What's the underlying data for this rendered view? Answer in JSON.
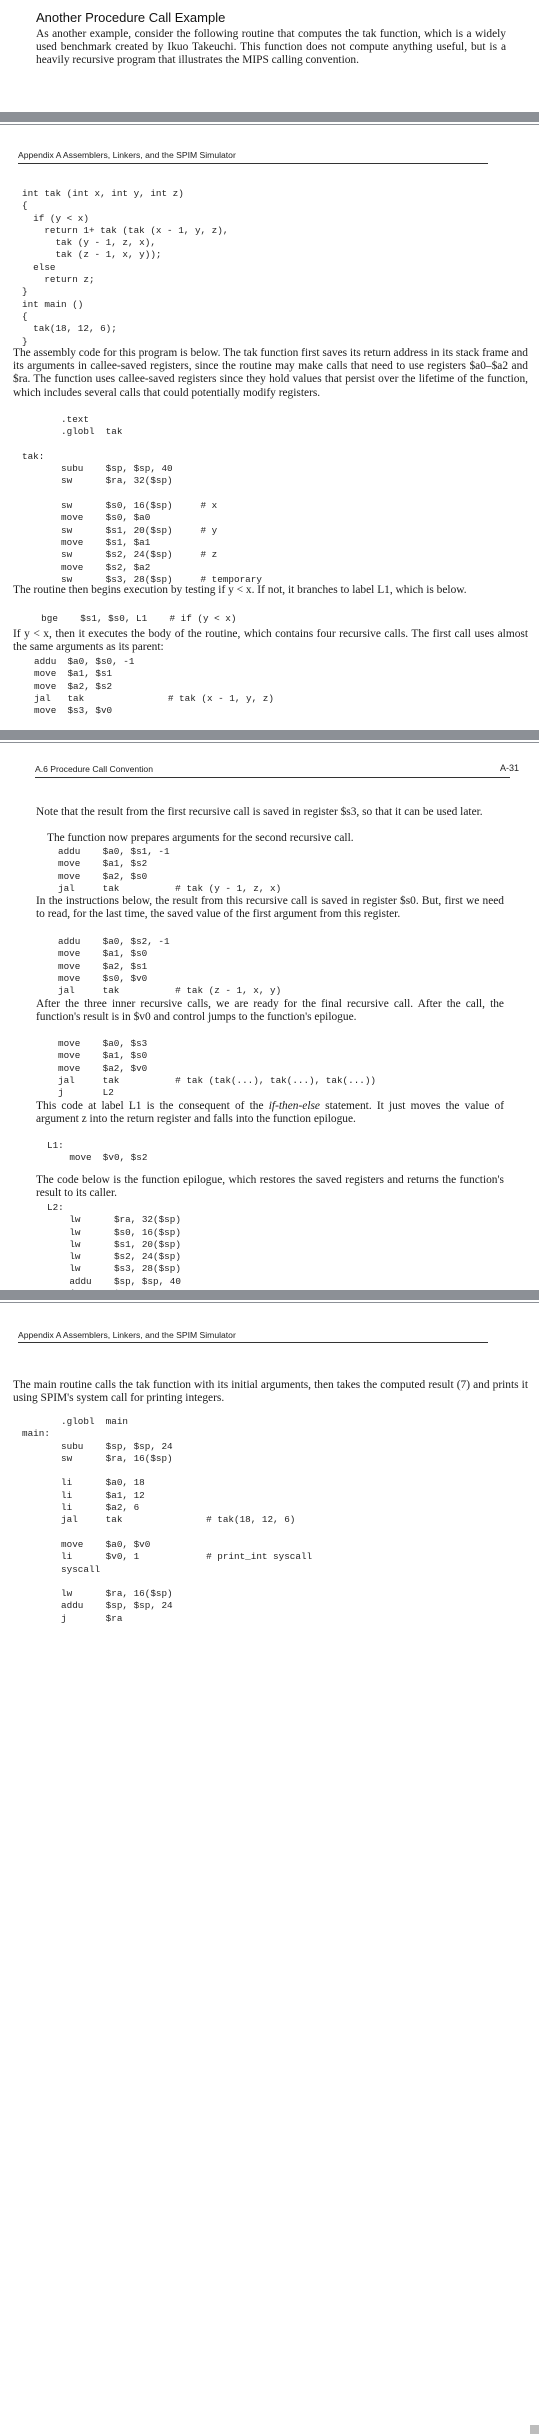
{
  "section1": {
    "title": "Another Procedure Call Example",
    "intro": "As another example, consider the following routine that computes the tak function, which is a widely used benchmark created by Ikuo Takeuchi. This function does not compute anything useful, but is a heavily recursive program that illustrates the MIPS calling convention."
  },
  "page1": {
    "header": "Appendix A   Assemblers, Linkers, and the SPIM Simulator",
    "c_code": "int tak (int x, int y, int z)\n{\n  if (y < x)\n    return 1+ tak (tak (x - 1, y, z),\n      tak (y - 1, z, x),\n      tak (z - 1, x, y));\n  else\n    return z;\n}\nint main ()\n{\n  tak(18, 12, 6);\n}",
    "p1": "The assembly code for this program is below. The tak function first saves its return address in its stack frame and its arguments in callee-saved registers, since the routine may make calls that need to use registers $a0–$a2 and $ra. The function uses callee-saved registers since they hold values that persist over the lifetime of the function, which includes several calls that could potentially modify registers.",
    "asm1": "       .text\n       .globl  tak\n\ntak:\n       subu    $sp, $sp, 40\n       sw      $ra, 32($sp)\n\n       sw      $s0, 16($sp)     # x\n       move    $s0, $a0\n       sw      $s1, 20($sp)     # y\n       move    $s1, $a1\n       sw      $s2, 24($sp)     # z\n       move    $s2, $a2\n       sw      $s3, 28($sp)     # temporary",
    "p2": "The routine then begins execution by testing if y < x. If not, it branches to label L1, which is below.",
    "asm2": "  bge    $s1, $s0, L1    # if (y < x)",
    "p3": "If y < x, then it executes the body of the routine, which contains four recursive calls. The first call uses almost the same arguments as its parent:",
    "asm3": "addu  $a0, $s0, -1\nmove  $a1, $s1\nmove  $a2, $s2\njal   tak               # tak (x - 1, y, z)\nmove  $s3, $v0"
  },
  "page2": {
    "header": "A.6   Procedure Call Convention",
    "page_number": "A-31",
    "p1": "Note that the result from the first recursive call is saved in register $s3, so that it can be used later.",
    "p2": "The function now prepares arguments for the second recursive call.",
    "asm1": "addu    $a0, $s1, -1\nmove    $a1, $s2\nmove    $a2, $s0\njal     tak          # tak (y - 1, z, x)",
    "p3": "In the instructions below, the result from this recursive call is saved in register $s0. But, first we need to read, for the last time, the saved value of the first argument from this register.",
    "asm2": "addu    $a0, $s2, -1\nmove    $a1, $s0\nmove    $a2, $s1\nmove    $s0, $v0\njal     tak          # tak (z - 1, x, y)",
    "p4": "After the three inner recursive calls, we are ready for the final recursive call. After the call, the function's result is in $v0 and control jumps to the function's epilogue.",
    "asm3": "move    $a0, $s3\nmove    $a1, $s0\nmove    $a2, $v0\njal     tak          # tak (tak(...), tak(...), tak(...))\nj       L2",
    "p5_a": "This code at label L1 is the consequent of the ",
    "p5_em": "if-then-else",
    "p5_b": " statement. It just moves the value of argument z into the return register and falls into the function epilogue.",
    "asm4": "L1:\n    move  $v0, $s2",
    "p6": "The code below is the function epilogue, which restores the saved registers and returns the function's result to its caller.",
    "asm5": "L2:\n    lw      $ra, 32($sp)\n    lw      $s0, 16($sp)\n    lw      $s1, 20($sp)\n    lw      $s2, 24($sp)\n    lw      $s3, 28($sp)\n    addu    $sp, $sp, 40\n    j       $ra"
  },
  "page3": {
    "header": "Appendix A   Assemblers, Linkers, and the SPIM Simulator",
    "p1": "The main routine calls the tak function with its initial arguments, then takes the computed result (7) and prints it using SPIM's system call for printing integers.",
    "asm1": "       .globl  main\nmain:\n       subu    $sp, $sp, 24\n       sw      $ra, 16($sp)\n\n       li      $a0, 18\n       li      $a1, 12\n       li      $a2, 6\n       jal     tak               # tak(18, 12, 6)\n\n       move    $a0, $v0\n       li      $v0, 1            # print_int syscall\n       syscall\n\n       lw      $ra, 16($sp)\n       addu    $sp, $sp, 24\n       j       $ra"
  }
}
